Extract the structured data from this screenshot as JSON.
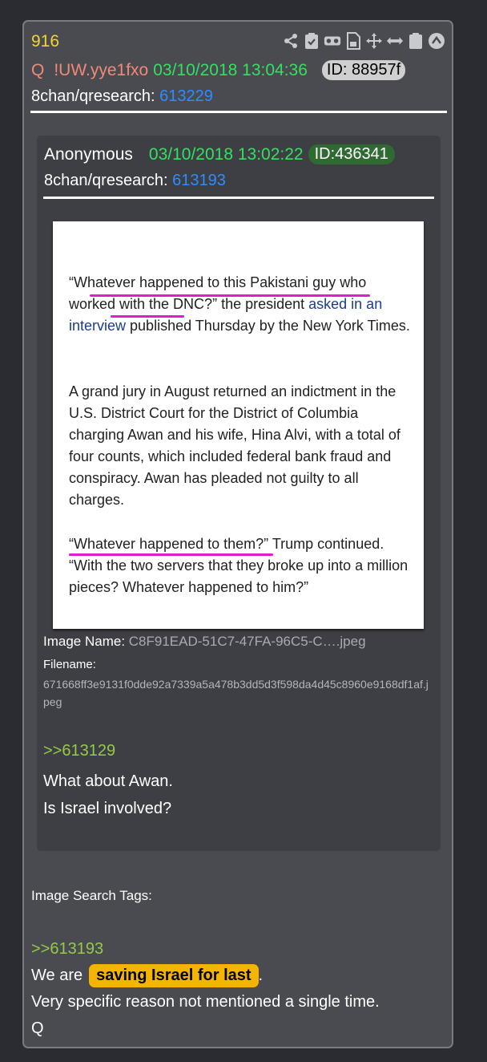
{
  "post": {
    "number": "916",
    "author": "Q",
    "tripcode": "!UW.yye1fxo",
    "date": "03/10/2018 13:04:36",
    "id": "ID: 88957f",
    "board": "8chan/qresearch:",
    "post_link": "613229"
  },
  "toolbar": [
    "share-icon",
    "check-clipboard-icon",
    "vr-icon",
    "document-icon",
    "move-icon",
    "resize-icon",
    "clipboard-icon",
    "chevron-up-circle-icon"
  ],
  "quoted": {
    "author": "Anonymous",
    "date": "03/10/2018 13:02:22",
    "id": "ID:436341",
    "board": "8chan/qresearch:",
    "post_link": "613193",
    "image_label": "Image Name:",
    "image_name": "C8F91EAD-51C7-47FA-96C5-C….jpeg",
    "filename_label": "Filename:",
    "filename": "671668ff3e9131f0dde92a7339a5a478b3dd5d3f598da4d45c8960e9168df1af.jpeg",
    "ref": ">>613129",
    "body": [
      "What about Awan.",
      "Is Israel involved?"
    ]
  },
  "article": {
    "p1_a": "“Whatever happened to this Pakistani guy who worked with the DNC?” the president ",
    "p1_link": "asked in an interview",
    "p1_b": " published Thursday by the New York Times.",
    "p2": "A grand jury in August returned an indictment in the U.S. District Court for the District of Columbia charging Awan and his wife, Hina Alvi, with a total of four counts, which included federal bank fraud and conspiracy. Awan has pleaded not guilty to all charges.",
    "p3": "“Whatever happened to them?” Trump continued. “With the two servers that they broke up into a million pieces? Whatever happened to him?”"
  },
  "tags_label": "Image Search Tags:",
  "reply": {
    "ref": ">>613193",
    "pre": "We are",
    "highlight": "saving Israel for last",
    "post": ".",
    "line2": "Very specific reason not mentioned a single time.",
    "sign": "Q"
  },
  "colors": {
    "accent_yellow": "#f2d33a",
    "date_green": "#33e05f",
    "link_blue": "#2f8cff",
    "quote_green": "#96c94a",
    "highlight": "#f5b400"
  }
}
